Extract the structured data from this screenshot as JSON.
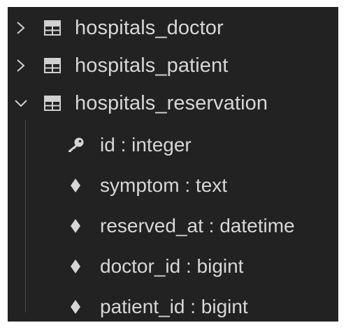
{
  "tree": {
    "tables": [
      {
        "label": "hospitals_doctor",
        "expanded": false
      },
      {
        "label": "hospitals_patient",
        "expanded": false
      },
      {
        "label": "hospitals_reservation",
        "expanded": true
      }
    ],
    "columns": [
      {
        "label": "id : integer",
        "icon": "key-icon"
      },
      {
        "label": "symptom : text",
        "icon": "diamond-icon"
      },
      {
        "label": "reserved_at : datetime",
        "icon": "diamond-icon"
      },
      {
        "label": "doctor_id : bigint",
        "icon": "diamond-icon"
      },
      {
        "label": "patient_id : bigint",
        "icon": "diamond-icon"
      }
    ]
  },
  "colors": {
    "panel_background": "#222222",
    "text": "#d7d7d7"
  }
}
